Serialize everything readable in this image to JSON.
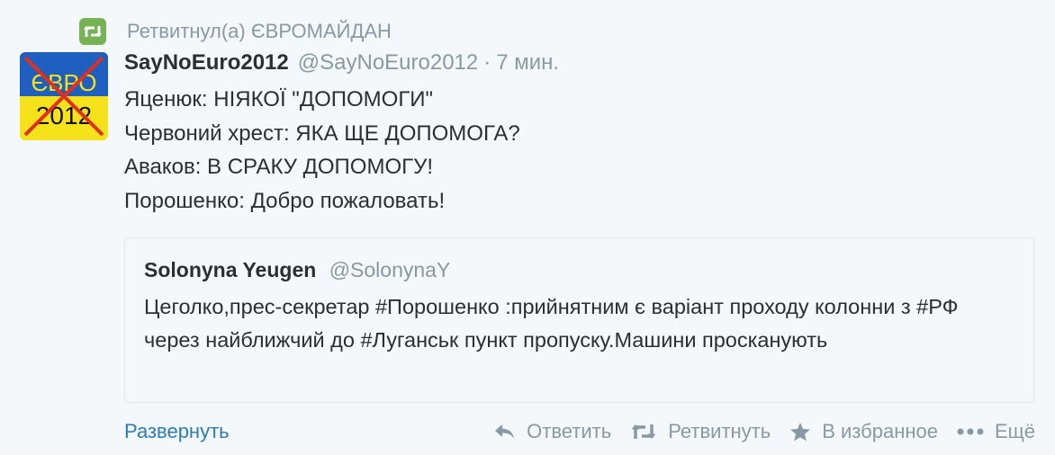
{
  "context": {
    "icon": "retweet-icon",
    "text": "Ретвитнул(а) ЄВРОМАЙДАН"
  },
  "avatar": {
    "text_top": "ЄВРО",
    "text_bottom": "2012",
    "colors": {
      "top": "#1f5fbf",
      "bottom": "#f5e21a",
      "cross": "#e0301e"
    }
  },
  "tweet": {
    "fullname": "SayNoEuro2012",
    "username": "@SayNoEuro2012",
    "separator": "·",
    "time": "7 мин.",
    "lines": [
      "Яценюк: НІЯКОЇ \"ДОПОМОГИ\"",
      "Червоний хрест: ЯКА ЩЕ ДОПОМОГА?",
      "Аваков: В СРАКУ ДОПОМОГУ!",
      "Порошенко: Добро пожаловать!"
    ]
  },
  "quote": {
    "fullname": "Solonyna Yeugen",
    "username": "@SolonynaY",
    "text": "Цеголко,прес-секретар #Порошенко :прийнятним є варіант проходу колонни з #РФ через найближчий до #Луганськ пункт пропуску.Машини просканують"
  },
  "footer": {
    "expand": "Развернуть",
    "reply": "Ответить",
    "retweet": "Ретвитнуть",
    "favorite": "В избранное",
    "more": "Ещё"
  },
  "colors": {
    "link": "#2b7bb9",
    "muted": "#8899a6",
    "text": "#292f33",
    "retweet_badge": "#77b255",
    "border": "#e1e8ed",
    "background": "#f5f8fa"
  }
}
